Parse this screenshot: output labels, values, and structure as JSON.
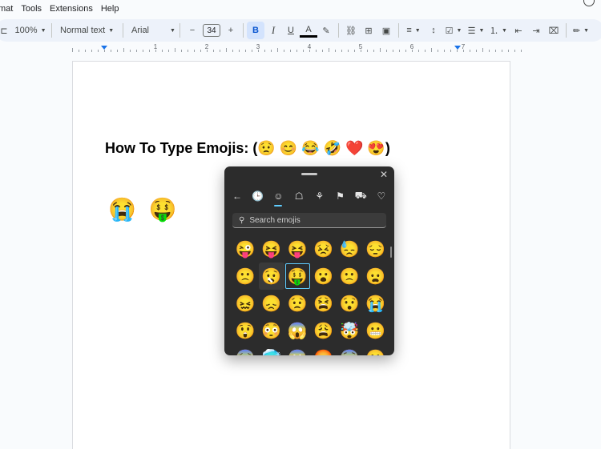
{
  "menu": [
    "mat",
    "Tools",
    "Extensions",
    "Help"
  ],
  "toolbar": {
    "zoom": "100%",
    "style": "Normal text",
    "font": "Arial",
    "font_size": "34",
    "bold": "B",
    "italic": "I",
    "underline": "U",
    "text_color_glyph": "A"
  },
  "ruler": {
    "numbers": [
      "1",
      "2",
      "3",
      "4",
      "5",
      "6",
      "7"
    ]
  },
  "document": {
    "title": "How To Type Emojis: (😟 😊 😂 🤣 ❤️ 😍)",
    "emoji_line": "😭 🤑"
  },
  "picker": {
    "close_glyph": "✕",
    "tabs": [
      {
        "icon": "back-arrow-icon",
        "glyph": "←"
      },
      {
        "icon": "recent-clock-icon",
        "glyph": "🕒"
      },
      {
        "icon": "smiley-icon",
        "glyph": "☺"
      },
      {
        "icon": "people-icon",
        "glyph": "☖"
      },
      {
        "icon": "celebration-icon",
        "glyph": "⚘"
      },
      {
        "icon": "flag-icon",
        "glyph": "⚑"
      },
      {
        "icon": "car-icon",
        "glyph": "⛟"
      },
      {
        "icon": "heart-icon",
        "glyph": "♡"
      }
    ],
    "search_placeholder": "Search emojis",
    "emojis": [
      "😜",
      "😝",
      "😝",
      "😣",
      "😓",
      "😔",
      "🙁",
      "😧",
      "🤑",
      "😮",
      "🙁",
      "😦",
      "😖",
      "😞",
      "😟",
      "😫",
      "😯",
      "😭",
      "😲",
      "😳",
      "😱",
      "😩",
      "🤯",
      "😬",
      "😰",
      "🥶",
      "😱",
      "😡",
      "😨",
      "😮"
    ],
    "selected_index": 8,
    "hover_index": 7
  },
  "colors": {
    "accent": "#60cdff",
    "toolbar_bg": "#edf2fa"
  }
}
